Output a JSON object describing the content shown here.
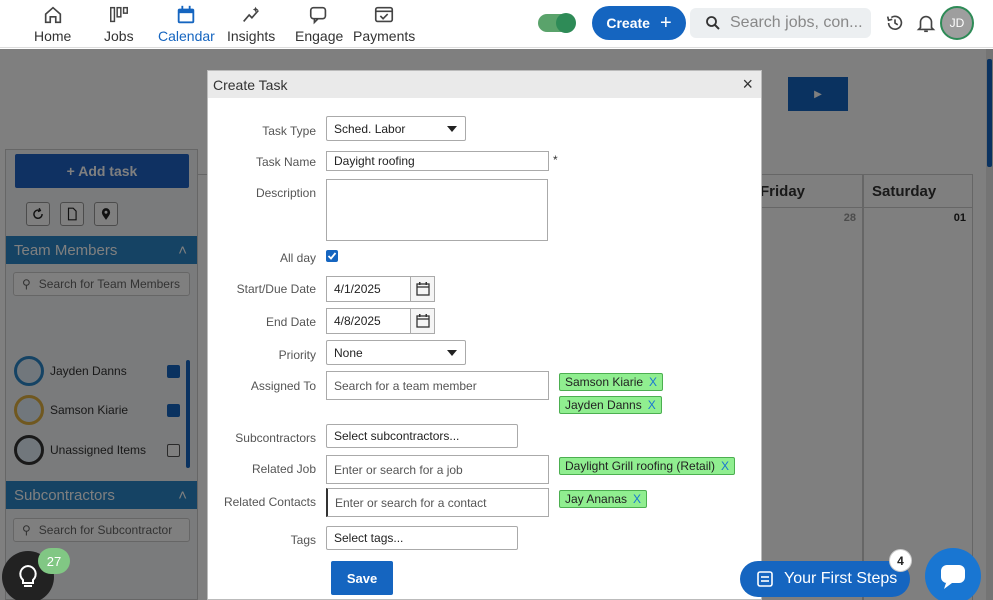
{
  "nav": {
    "items": [
      {
        "label": "Home",
        "icon": "home-icon"
      },
      {
        "label": "Jobs",
        "icon": "jobs-icon"
      },
      {
        "label": "Calendar",
        "icon": "calendar-icon",
        "active": true
      },
      {
        "label": "Insights",
        "icon": "insights-icon"
      },
      {
        "label": "Engage",
        "icon": "engage-icon"
      },
      {
        "label": "Payments",
        "icon": "payments-icon"
      }
    ],
    "create_label": "Create",
    "search_placeholder": "Search jobs, con...",
    "avatar_initials": "JD"
  },
  "sidebar": {
    "add_task_label": "+ Add task",
    "team_members_title": "Team Members",
    "team_search_placeholder": "Search for Team Members",
    "members": [
      {
        "name": "Jayden Danns",
        "checked": true
      },
      {
        "name": "Samson Kiarie",
        "checked": true
      },
      {
        "name": "Unassigned Items",
        "checked": false
      }
    ],
    "subcontractors_title": "Subcontractors",
    "sub_search_placeholder": "Search for Subcontractor"
  },
  "calendar": {
    "days": [
      "Friday",
      "Saturday"
    ],
    "dates": [
      "28",
      "01"
    ]
  },
  "modal": {
    "title": "Create Task",
    "labels": {
      "task_type": "Task Type",
      "task_name": "Task Name",
      "description": "Description",
      "all_day": "All day",
      "start_date": "Start/Due Date",
      "end_date": "End Date",
      "priority": "Priority",
      "assigned_to": "Assigned To",
      "subcontractors": "Subcontractors",
      "related_job": "Related Job",
      "related_contacts": "Related Contacts",
      "tags": "Tags"
    },
    "values": {
      "task_type": "Sched. Labor",
      "task_name": "Dayight roofing",
      "required_mark": "*",
      "start_date": "4/1/2025",
      "end_date": "4/8/2025",
      "priority": "None"
    },
    "placeholders": {
      "assigned_to": "Search for a team member",
      "subcontractors": "Select subcontractors...",
      "related_job": "Enter or search for a job",
      "related_contacts": "Enter or search for a contact",
      "tags": "Select tags..."
    },
    "assigned_tags": [
      "Samson Kiarie",
      "Jayden Danns"
    ],
    "job_tags": [
      "Daylight Grill roofing (Retail)"
    ],
    "contact_tags": [
      "Jay Ananas"
    ],
    "tag_remove": "X",
    "save_label": "Save"
  },
  "widgets": {
    "tips_count": "27",
    "first_steps_label": "Your First Steps",
    "first_steps_count": "4"
  }
}
